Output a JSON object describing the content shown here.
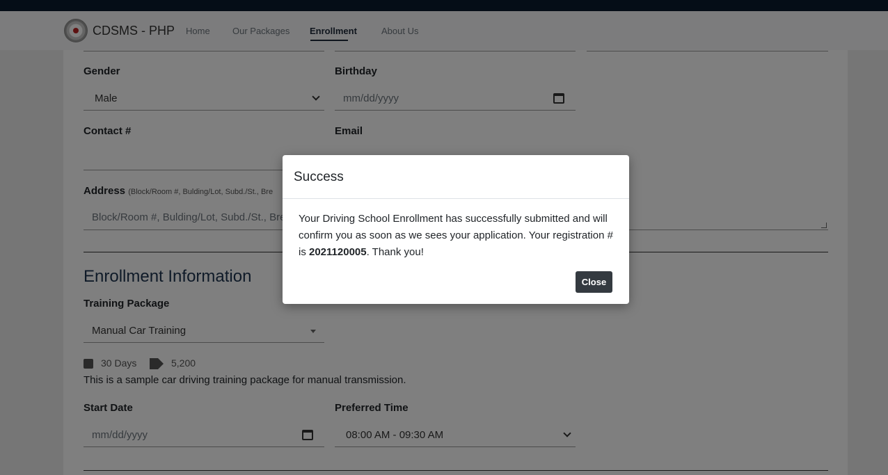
{
  "nav": {
    "brand": "CDSMS - PHP",
    "links": [
      "Home",
      "Our Packages",
      "Enrollment",
      "About Us"
    ],
    "active": "Enrollment"
  },
  "form": {
    "gender_label": "Gender",
    "gender_value": "Male",
    "birthday_label": "Birthday",
    "birthday_placeholder": "mm/dd/yyyy",
    "contact_label": "Contact #",
    "email_label": "Email",
    "address_label": "Address",
    "address_hint": "(Block/Room #, Bulding/Lot, Subd./St., Bre",
    "address_placeholder": "Block/Room #, Bulding/Lot, Subd./St., Bre"
  },
  "enrollment": {
    "title": "Enrollment Information",
    "package_label": "Training Package",
    "package_value": "Manual Car Training",
    "duration": "30 Days",
    "price": "5,200",
    "description": "This is a sample car driving training package for manual transmission.",
    "start_label": "Start Date",
    "start_placeholder": "mm/dd/yyyy",
    "time_label": "Preferred Time",
    "time_value": "08:00 AM - 09:30 AM"
  },
  "modal": {
    "title": "Success",
    "message_pre": "Your Driving School Enrollment has successfully submitted and will confirm you as soon as we sees your application. Your registration # is ",
    "reg_no": "2021120005",
    "message_post": ". Thank you!",
    "close_label": "Close"
  }
}
